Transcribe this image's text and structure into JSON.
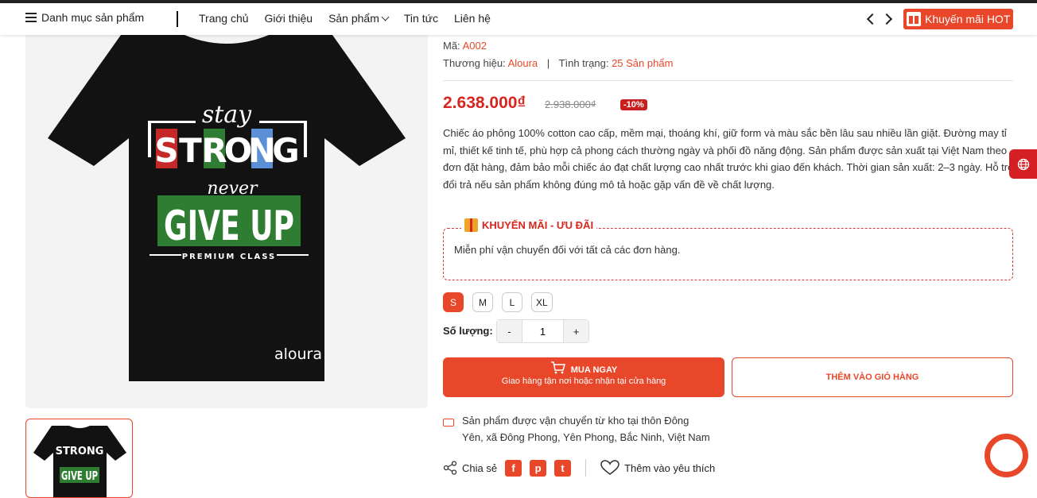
{
  "nav": {
    "category_label": "Danh mục sản phẩm",
    "links": [
      "Trang chủ",
      "Giới thiệu",
      "Sản phẩm",
      "Tin tức",
      "Liên hệ"
    ],
    "promo_label": "Khuyến mãi HOT"
  },
  "product_image": {
    "title_top": "stay",
    "title_mid": "STRONG",
    "title_script": "never",
    "title_main": "GIVE UP",
    "subtitle": "PREMIUM CLASS",
    "brand_mark": "aloura",
    "strong_letters": [
      "S",
      "T",
      "R",
      "O",
      "N",
      "G"
    ],
    "letter_colors": [
      "#c62828",
      "#ffffff",
      "#2e7d32",
      "#ffffff",
      "#5b8fd6",
      "#ffffff"
    ]
  },
  "product": {
    "code_label": "Mã:",
    "code": "A002",
    "brand_label": "Thương hiệu:",
    "brand": "Aloura",
    "separator": "|",
    "status_label": "Tình trạng:",
    "status": "25 Sản phẩm",
    "price": "2.638.000₫",
    "old_price": "2.938.000₫",
    "discount": "-10%",
    "description": "Chiếc áo phông 100% cotton cao cấp, mềm mại, thoáng khí, giữ form và màu sắc bền lâu sau nhiều lần giặt. Đường may tỉ mỉ, thiết kế tinh tế, phù hợp cả phong cách thường ngày và phối đồ năng động. Sản phẩm được sản xuất tại Việt Nam theo đơn đặt hàng, đảm bảo mỗi chiếc áo đạt chất lượng cao nhất trước khi giao đến khách. Thời gian sản xuất: 2–3 ngày. Hỗ trợ đổi trả nếu sản phẩm không đúng mô tả hoặc gặp vấn đề về chất lượng."
  },
  "promo": {
    "title": "KHUYẾN MÃI - ƯU ĐÃI",
    "text": "Miễn phí vận chuyển đối với tất cả các đơn hàng."
  },
  "sizes": {
    "options": [
      "S",
      "M",
      "L",
      "XL"
    ],
    "selected": "S"
  },
  "quantity": {
    "label": "Số lượng:",
    "minus": "-",
    "plus": "+",
    "value": "1"
  },
  "actions": {
    "buy_now": "MUA NGAY",
    "buy_now_sub": "Giao hàng tận nơi hoặc nhận tại cửa hàng",
    "add_to_cart": "THÊM VÀO GIỎ HÀNG"
  },
  "shipping": {
    "line1": "Sản phẩm được vận chuyển từ kho tại thôn Đông",
    "line2": "Yên, xã Đông Phong, Yên Phong, Bắc Ninh, Việt Nam"
  },
  "share": {
    "label": "Chia sẻ",
    "networks": [
      "f",
      "p",
      "t"
    ],
    "wishlist": "Thêm vào yêu thích"
  },
  "colors": {
    "accent": "#e8472a",
    "price": "#d8261e",
    "discount_bg": "#c81f1f"
  },
  "icons": {
    "menu": "hamburger-icon",
    "gift": "gift-icon",
    "cart": "cart-icon",
    "truck": "truck-icon",
    "share": "share-icon",
    "heart": "heart-icon",
    "globe": "globe-icon",
    "chat": "chat-icon"
  }
}
